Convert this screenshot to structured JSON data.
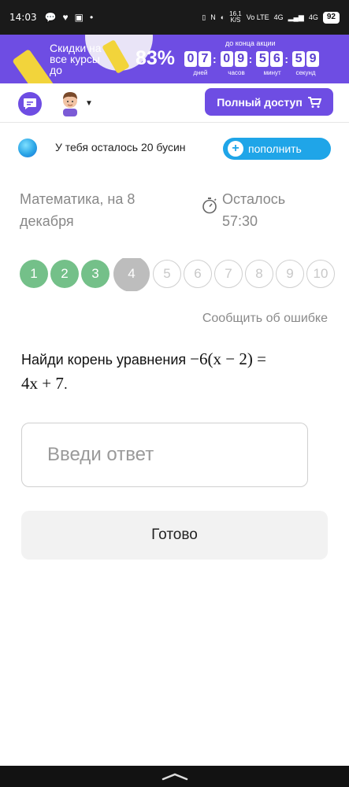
{
  "status_bar": {
    "time": "14:03",
    "net_speed_value": "16,1",
    "net_speed_unit": "K/S",
    "vo_lte": "Vo LTE",
    "network_1": "4G",
    "network_2": "4G",
    "battery": "92"
  },
  "promo": {
    "text": "Скидки на все курсы до",
    "percent": "83%",
    "until_label": "до конца акции",
    "timer": [
      {
        "digits": [
          "0",
          "7"
        ],
        "label": "дней"
      },
      {
        "digits": [
          "0",
          "9"
        ],
        "label": "часов"
      },
      {
        "digits": [
          "5",
          "6"
        ],
        "label": "минут"
      },
      {
        "digits": [
          "5",
          "9"
        ],
        "label": "секунд"
      }
    ],
    "accent_color": "#6e4de3"
  },
  "header": {
    "full_access_label": "Полный доступ"
  },
  "beads": {
    "text": "У тебя осталось 20 бусин",
    "refill_label": "пополнить"
  },
  "info": {
    "subject": "Математика, на 8 декабря",
    "remaining": "Осталось 57:30"
  },
  "steps": [
    {
      "label": "1",
      "state": "done"
    },
    {
      "label": "2",
      "state": "done"
    },
    {
      "label": "3",
      "state": "done"
    },
    {
      "label": "4",
      "state": "current"
    },
    {
      "label": "5",
      "state": "todo"
    },
    {
      "label": "6",
      "state": "todo"
    },
    {
      "label": "7",
      "state": "todo"
    },
    {
      "label": "8",
      "state": "todo"
    },
    {
      "label": "9",
      "state": "todo"
    },
    {
      "label": "10",
      "state": "todo"
    }
  ],
  "report_label": "Сообщить об ошибке",
  "question": {
    "prefix": "Найди корень уравнения ",
    "equation_line1": "−6(x − 2) =",
    "equation_line2": "4x + 7",
    "suffix": "."
  },
  "answer": {
    "placeholder": "Введи ответ",
    "value": ""
  },
  "done_label": "Готово"
}
